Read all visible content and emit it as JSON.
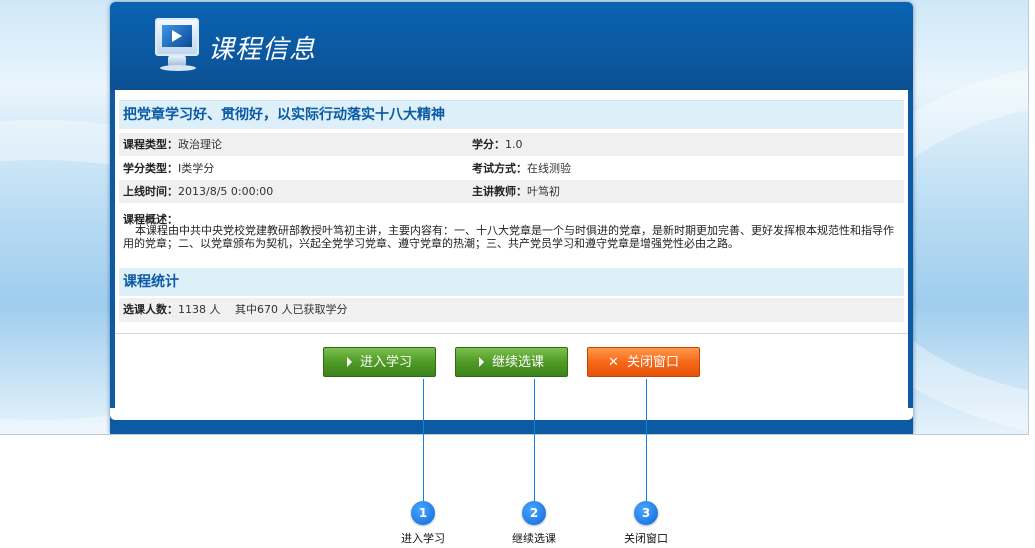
{
  "window": {
    "title": "课程信息"
  },
  "course": {
    "title": "把党章学习好、贯彻好，以实际行动落实十八大精神",
    "fields": [
      {
        "label": "课程类型：",
        "value": "政治理论"
      },
      {
        "label": "学分：",
        "value": "1.0"
      },
      {
        "label": "学分类型：",
        "value": "I类学分"
      },
      {
        "label": "考试方式：",
        "value": "在线测验"
      },
      {
        "label": "上线时间：",
        "value": "2013/8/5 0:00:00"
      },
      {
        "label": "主讲教师：",
        "value": "叶笃初"
      }
    ],
    "description_label": "课程概述：",
    "description": "本课程由中共中央党校党建教研部教授叶笃初主讲，主要内容有：一、十八大党章是一个与时俱进的党章，是新时期更加完善、更好发挥根本规范性和指导作用的党章；二、以党章颁布为契机，兴起全党学习党章、遵守党章的热潮；三、共产党员学习和遵守党章是增强党性必由之路。"
  },
  "stats": {
    "title": "课程统计",
    "label": "选课人数：",
    "value": "1138 人　 其中670 人已获取学分"
  },
  "buttons": {
    "enter": "进入学习",
    "continue": "继续选课",
    "close": "关闭窗口"
  },
  "callouts": [
    {
      "number": "1",
      "label": "进入学习"
    },
    {
      "number": "2",
      "label": "继续选课"
    },
    {
      "number": "3",
      "label": "关闭窗口"
    }
  ],
  "colors": {
    "panel": "#0b5aa2",
    "title_text": "#0a5aa5",
    "section_bg": "#ddeff9",
    "button_green": "#4f9a26",
    "button_orange": "#f66818",
    "callout": "#0c68d8"
  },
  "icons": [
    "monitor-icon",
    "play-arrow-icon",
    "close-x-icon"
  ]
}
